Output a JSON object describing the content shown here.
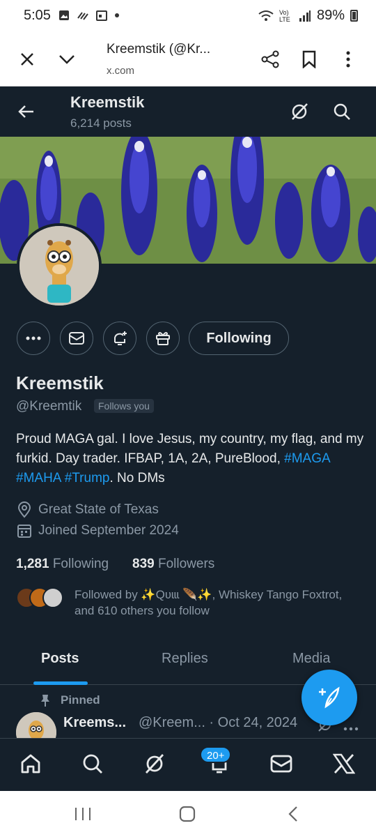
{
  "status_bar": {
    "time": "5:05",
    "battery": "89%",
    "network": "Vo) LTE"
  },
  "browser": {
    "page_title": "Kreemstik (@Kr...",
    "domain": "x.com"
  },
  "header": {
    "name": "Kreemstik",
    "posts_count": "6,214 posts"
  },
  "profile": {
    "display_name": "Kreemstik",
    "handle": "@Kreemtik",
    "follows_you": "Follows you",
    "following_button": "Following",
    "bio_text": "Proud MAGA gal. I love Jesus, my country, my flag, and my furkid. Day trader. IFBAP, 1A, 2A, PureBlood, ",
    "bio_hashtags": [
      "#MAGA",
      "#MAHA",
      "#Trump"
    ],
    "bio_suffix": ". No DMs",
    "location": "Great State of Texas",
    "joined": "Joined September 2024",
    "following_count": "1,281",
    "following_label": "Following",
    "followers_count": "839",
    "followers_label": "Followers",
    "followed_by": "Followed by ✨Qʋɩɩɩ 🪶✨, Whiskey Tango Foxtrot, and 610 others you follow"
  },
  "tabs": [
    {
      "label": "Posts",
      "active": true
    },
    {
      "label": "Replies",
      "active": false
    },
    {
      "label": "Media",
      "active": false
    }
  ],
  "pinned_post": {
    "pinned_label": "Pinned",
    "author": "Kreems...",
    "handle_date": "@Kreem... · Oct 24, 2024"
  },
  "bottom_nav": {
    "notification_badge": "20+",
    "items": [
      "home-icon",
      "search-icon",
      "grok-icon",
      "notifications-icon",
      "messages-icon",
      "x-premium-icon"
    ]
  },
  "colors": {
    "accent": "#1d9bf0",
    "background": "#15202b",
    "muted": "#8b98a5"
  }
}
